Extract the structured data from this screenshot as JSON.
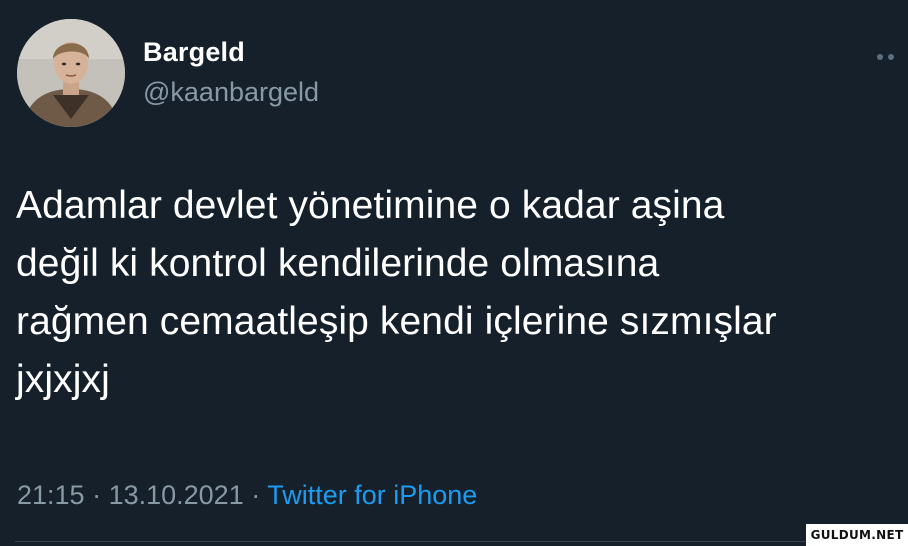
{
  "tweet": {
    "author": {
      "name": "Bargeld",
      "handle": "@kaanbargeld",
      "avatar_icon": "profile-photo"
    },
    "more_icon": "more-options-icon",
    "text": "Adamlar devlet yönetimine o kadar aşina\ndeğil ki kontrol kendilerinde olmasına\nrağmen cemaatleşip kendi içlerine sızmışlar\njxjxjxj",
    "time": "21:15",
    "separator": " · ",
    "date": "13.10.2021",
    "source": "Twitter for iPhone"
  },
  "watermark": "GULDUM.NET",
  "colors": {
    "background": "#15202b",
    "primary_text": "#ffffff",
    "secondary_text": "#8899a6",
    "accent": "#1d9bf0"
  }
}
